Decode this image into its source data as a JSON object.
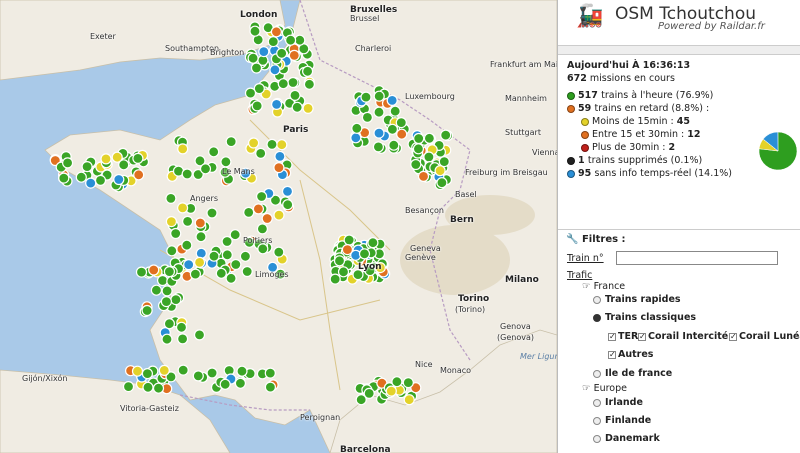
{
  "app": {
    "title": "OSM Tchoutchou",
    "subtitle": "Powered by Raildar.fr",
    "logo_icon": "train-icon"
  },
  "stats": {
    "datetime": "Aujourd'hui À 16:36:13",
    "missions_count": "672",
    "missions_text": "missions en cours",
    "rows": [
      {
        "count": "517",
        "text": "trains à l'heure (76.9%)",
        "color": "#2e9e1f"
      },
      {
        "count": "59",
        "text": "trains en retard (8.8%) :",
        "color": "#e07020"
      },
      {
        "count": "",
        "text": "Moins de 15min :",
        "value": "45",
        "color": "#e3d22a",
        "sub": true
      },
      {
        "count": "",
        "text": "Entre 15 et 30min :",
        "value": "12",
        "color": "#e07020",
        "sub": true
      },
      {
        "count": "",
        "text": "Plus de 30min :",
        "value": "2",
        "color": "#c0201a",
        "sub": true
      },
      {
        "count": "1",
        "text": "trains supprimés (0.1%)",
        "color": "#222222"
      },
      {
        "count": "95",
        "text": "sans info temps-réel (14.1%)",
        "color": "#2a8fd6"
      }
    ],
    "pie": [
      {
        "label": "à l'heure",
        "fraction": 0.769,
        "color": "#2e9e1f"
      },
      {
        "label": "retard",
        "fraction": 0.088,
        "color": "#e3d22a"
      },
      {
        "label": "supprimés",
        "fraction": 0.001,
        "color": "#222222"
      },
      {
        "label": "sans info",
        "fraction": 0.141,
        "color": "#2a8fd6"
      }
    ]
  },
  "filters": {
    "title": "Filtres :",
    "train_label": "Train n°",
    "train_value": "",
    "trafic_label": "Trafic",
    "france_label": "France",
    "rapides": "Trains rapides",
    "classiques": "Trains classiques",
    "ter": "TER",
    "corail_intercite": "Corail Intercité",
    "corail_lunea": "Corail Lunéa",
    "autres": "Autres",
    "iledefrance": "Ile de france",
    "europe_label": "Europe",
    "irlande": "Irlande",
    "finlande": "Finlande",
    "danemark": "Danemark"
  },
  "map": {
    "cities": [
      "Exeter",
      "Southampton",
      "Brighton",
      "London",
      "Bruxelles",
      "Brussel",
      "Charleroi",
      "Luxembourg",
      "Frankfurt am Main",
      "Mannheim",
      "Stuttgart",
      "Freiburg im Breisgau",
      "Basel",
      "Bern",
      "Geneva",
      "Genève",
      "Milano",
      "Torino",
      "(Torino)",
      "Genova",
      "(Genova)",
      "Monaco",
      "Nice",
      "Paris",
      "Le Mans",
      "Angers",
      "Poitiers",
      "Limoges",
      "Lyon",
      "Perpignan",
      "Gijón/Xixón",
      "Vitoria-Gasteiz",
      "Barcelona",
      "Besançon",
      "Vienna",
      "Mer Ligure"
    ],
    "markers": {
      "green": 517,
      "late": 59,
      "unknown": 95
    }
  }
}
